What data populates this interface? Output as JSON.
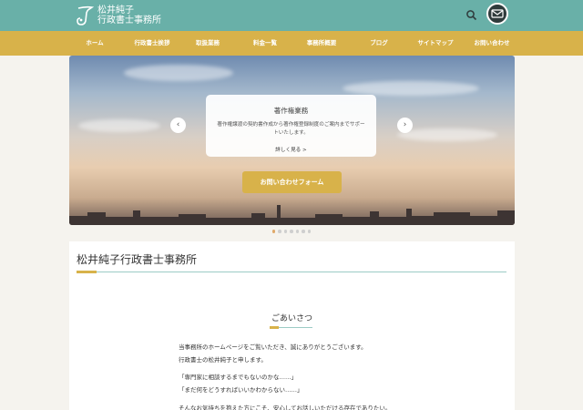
{
  "header": {
    "logo_line1": "松井純子",
    "logo_line2": "行政書士事務所"
  },
  "nav": {
    "items": [
      "ホーム",
      "行政書士挨拶",
      "取扱業務",
      "料金一覧",
      "事務所概要",
      "ブログ",
      "サイトマップ",
      "お問い合わせ"
    ]
  },
  "hero": {
    "card_title": "著作権業務",
    "card_text": "著作権譲渡の契約書作成から著作権登録制度のご案内までサポートいたします。",
    "card_more": "詳しく見る >",
    "prev_arrow": "‹",
    "next_arrow": "›",
    "cta_label": "お問い合わせフォーム",
    "slide_count": 7,
    "active_slide": 1
  },
  "main": {
    "site_title": "松井純子行政書士事務所",
    "section_title": "ごあいさつ",
    "paragraphs": [
      "当事務所のホームページをご覧いただき、誠にありがとうございます。",
      "行政書士の松井純子と申します。",
      "「専門家に相談するまでもないのかな……」",
      "「まだ何をどうすればいいかわからない……」",
      "そんなお気持ちを抱えた方にこそ、安心してお話しいただける存在でありたい。"
    ]
  },
  "colors": {
    "topbar": "#69b0a8",
    "navbar": "#d8b24a",
    "accent": "#d8b24a",
    "rule": "#9ccbc5"
  }
}
